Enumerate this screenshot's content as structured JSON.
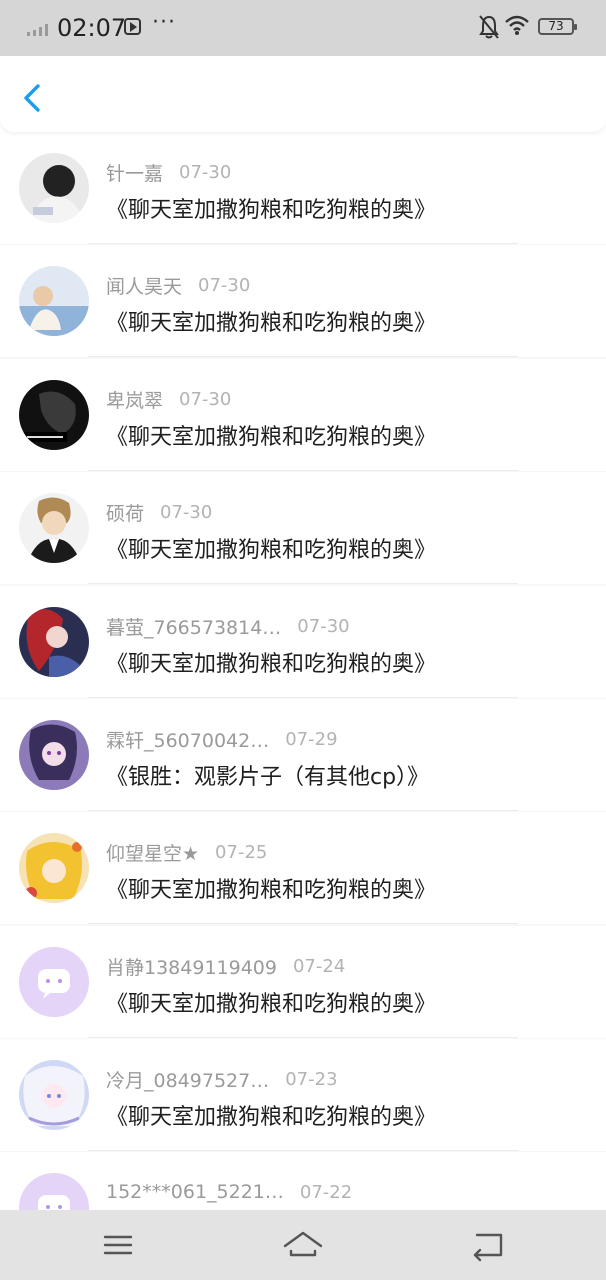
{
  "status_bar": {
    "time": "02:07",
    "more": "···",
    "battery": "73"
  },
  "header": {
    "back_icon": "chevron-left-icon",
    "accent": "#1a9ff0"
  },
  "comments": [
    {
      "name": "针一嘉",
      "date": "07-30",
      "title": "《聊天室加撒狗粮和吃狗粮的奥》"
    },
    {
      "name": "闻人昊天",
      "date": "07-30",
      "title": "《聊天室加撒狗粮和吃狗粮的奥》"
    },
    {
      "name": "卑岚翠",
      "date": "07-30",
      "title": "《聊天室加撒狗粮和吃狗粮的奥》"
    },
    {
      "name": "硕荷",
      "date": "07-30",
      "title": "《聊天室加撒狗粮和吃狗粮的奥》"
    },
    {
      "name": "暮萤_766573814…",
      "date": "07-30",
      "title": "《聊天室加撒狗粮和吃狗粮的奥》"
    },
    {
      "name": "霖轩_56070042…",
      "date": "07-29",
      "title": "《银胜：观影片子（有其他cp）》"
    },
    {
      "name": "仰望星空★",
      "date": "07-25",
      "title": "《聊天室加撒狗粮和吃狗粮的奥》"
    },
    {
      "name": "肖静13849119409",
      "date": "07-24",
      "title": "《聊天室加撒狗粮和吃狗粮的奥》"
    },
    {
      "name": "冷月_08497527…",
      "date": "07-23",
      "title": "《聊天室加撒狗粮和吃狗粮的奥》"
    },
    {
      "name": "152***061_5221…",
      "date": "07-22",
      "title": ""
    }
  ],
  "nav": {
    "menu_icon": "menu-icon",
    "home_icon": "home-icon",
    "back_icon": "return-icon"
  }
}
